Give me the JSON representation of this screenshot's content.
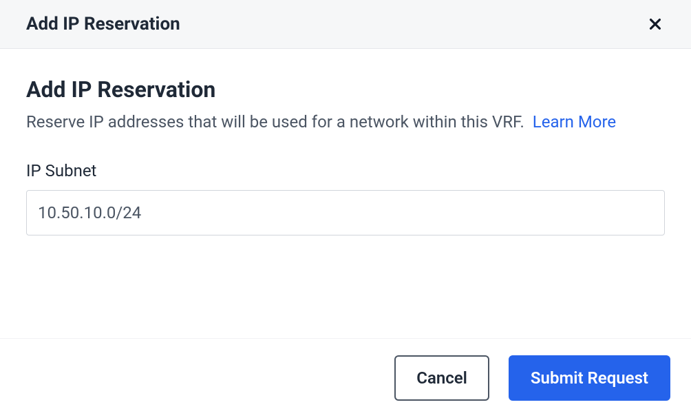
{
  "header": {
    "title": "Add IP Reservation"
  },
  "body": {
    "title": "Add IP Reservation",
    "description": "Reserve IP addresses that will be used for a network within this VRF.",
    "learn_more_label": "Learn More",
    "ip_subnet": {
      "label": "IP Subnet",
      "value": "10.50.10.0/24"
    }
  },
  "footer": {
    "cancel_label": "Cancel",
    "submit_label": "Submit Request"
  }
}
